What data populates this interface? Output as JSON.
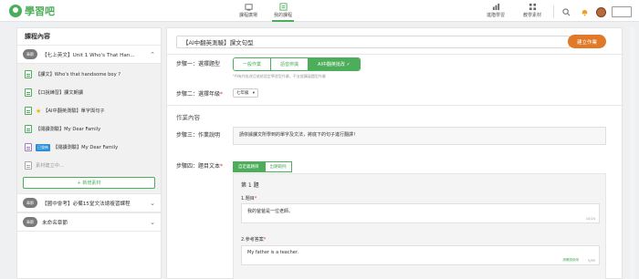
{
  "brand": {
    "name": "學習吧"
  },
  "nav": {
    "center": [
      {
        "label": "課程廣場",
        "active": false
      },
      {
        "label": "我的課程",
        "active": true
      }
    ],
    "right": [
      {
        "label": "進階學習"
      },
      {
        "label": "教學素材"
      }
    ]
  },
  "sidebar": {
    "heading": "課程內容",
    "chapter_badge": "章節",
    "chapters": [
      {
        "title": "【七上英文】Unit 1 Who's That Han...",
        "expanded": true
      }
    ],
    "materials": [
      {
        "text": "【課文】Who's that handsome boy ?",
        "icon": "doc",
        "star": false,
        "tag": ""
      },
      {
        "text": "【口說練習】課文朗讀",
        "icon": "doc",
        "star": false,
        "tag": ""
      },
      {
        "text": "【AI中翻英測驗】單字與句子",
        "icon": "doc",
        "star": true,
        "tag": ""
      },
      {
        "text": "【閱讀測驗】My Dear Family",
        "icon": "doc",
        "star": false,
        "tag": ""
      },
      {
        "text": "【閱讀測驗】My Dear Family",
        "icon": "purple",
        "star": false,
        "tag": "已發佈"
      },
      {
        "text": "素材建立中...",
        "icon": "gray",
        "star": false,
        "tag": "",
        "muted": true
      }
    ],
    "add_material": "+  新增素材",
    "chapters_more": [
      {
        "title": "【國中會考】必備15堂文法總複習課程"
      },
      {
        "title": "未命名章節"
      }
    ]
  },
  "main": {
    "title_value": "【AI中翻英測驗】課文句型",
    "create_button": "建立作業",
    "step1_label": "步驟一：選擇題型",
    "types": [
      {
        "label": "一般作業",
        "active": false
      },
      {
        "label": "語音辨識",
        "active": false
      },
      {
        "label": "AI中翻英批改  ✓",
        "active": true
      }
    ],
    "step1_hint": "*AI有作批改且能依設定學習型作業，不支援擴展題型作業",
    "step2_label": "步驟二：選擇年級",
    "grade_value": "七年級",
    "section_title": "作業內容",
    "step3_label": "步驟三：作業說明",
    "description": "請依據課文所學到的單字及文法，將底下的句子進行翻譯！",
    "step4_label": "步驟四：題目文本",
    "tabs": [
      {
        "label": "自定義題目",
        "active": true
      },
      {
        "label": "出題範例",
        "active": false
      }
    ],
    "question": {
      "number": "第 1 題",
      "q_label": "1.題目",
      "q_value": "我的爸爸是一位老師。",
      "q_counter": "10/24",
      "a_label": "2.參考答案",
      "a_value": "My father is a teacher.",
      "a_link": "請確認使用",
      "a_counter": "5/99",
      "required_mark": "*"
    }
  }
}
